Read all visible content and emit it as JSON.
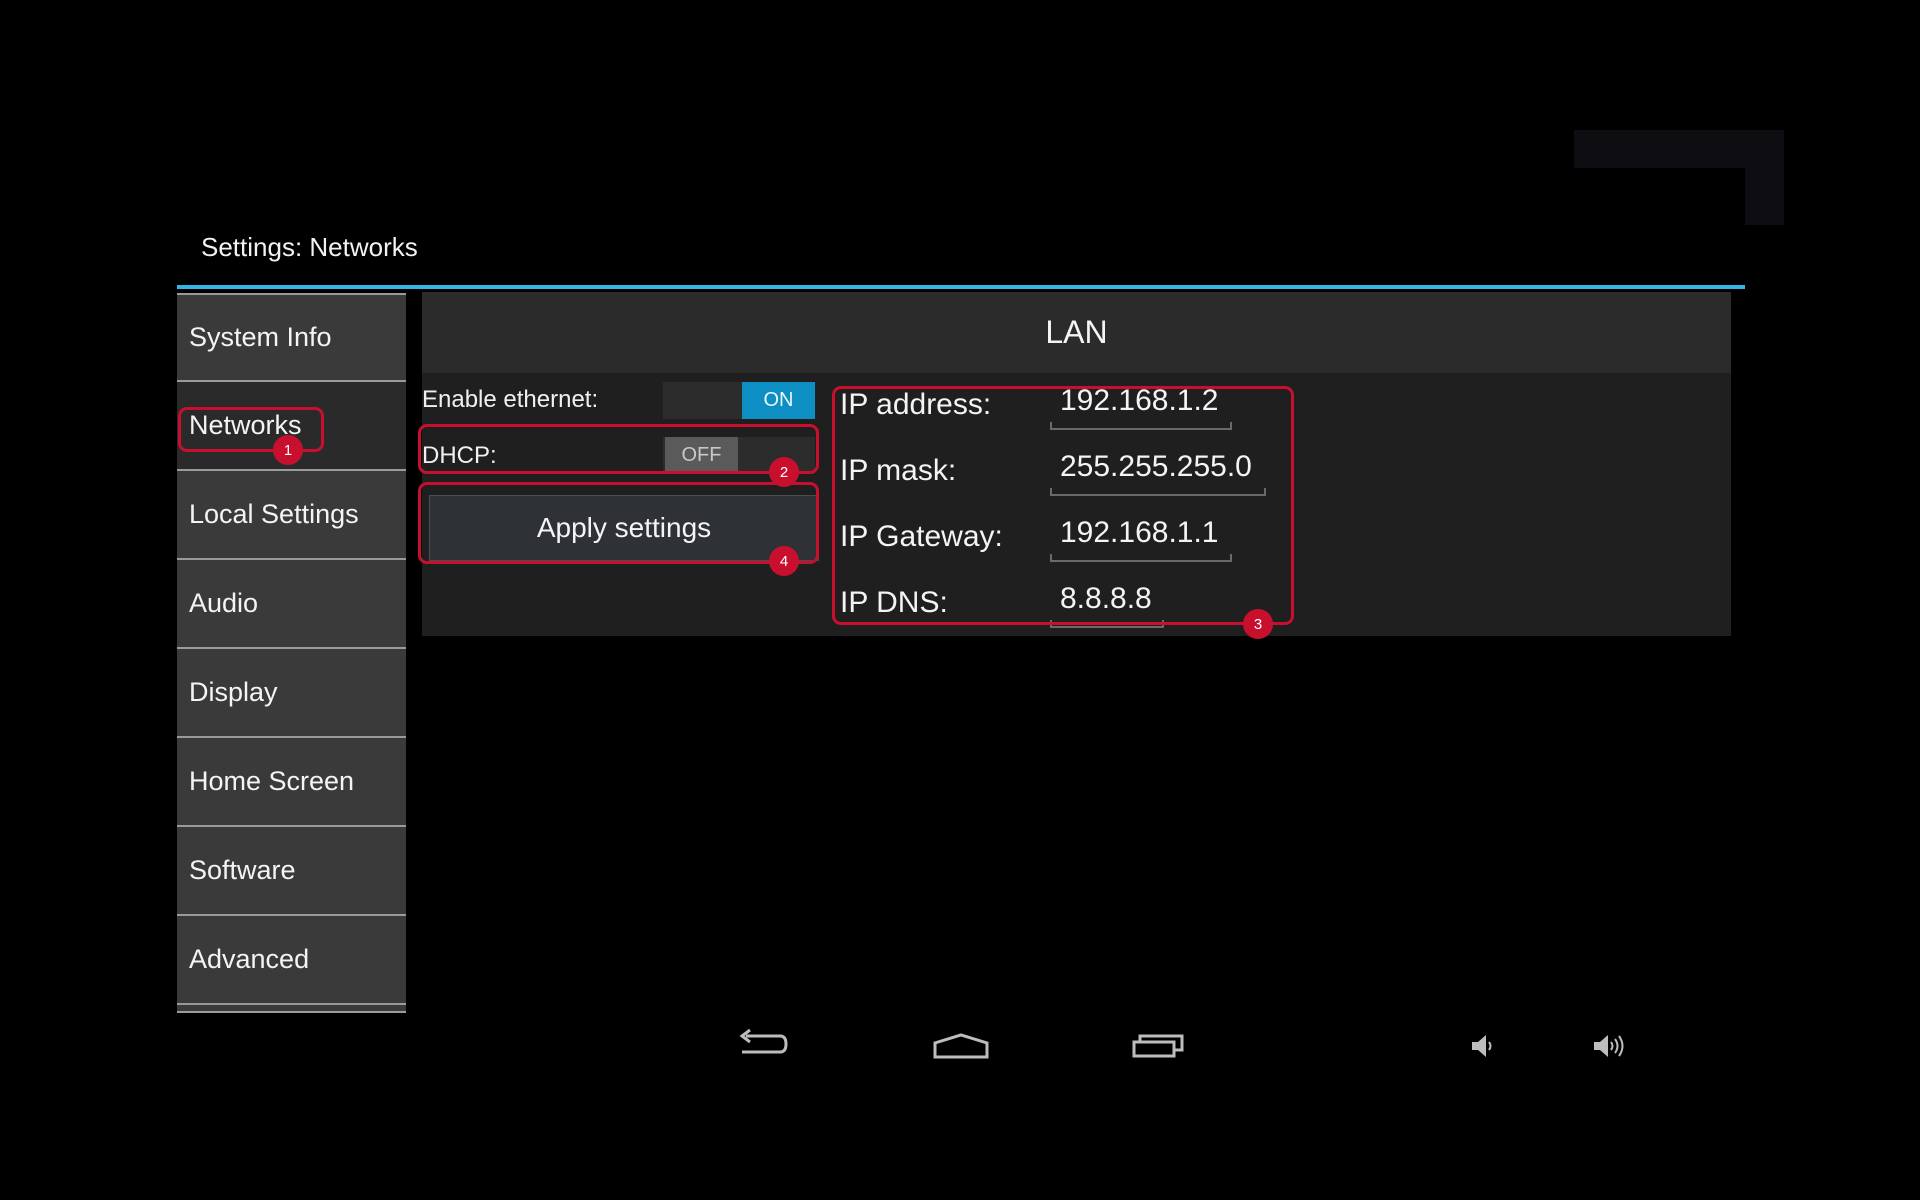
{
  "app": {
    "title": "Settings: Networks"
  },
  "sidebar": {
    "items": [
      {
        "label": "System Info"
      },
      {
        "label": "Networks"
      },
      {
        "label": "Local Settings"
      },
      {
        "label": "Audio"
      },
      {
        "label": "Display"
      },
      {
        "label": "Home Screen"
      },
      {
        "label": "Software"
      },
      {
        "label": "Advanced"
      }
    ],
    "selected": "Networks"
  },
  "lan": {
    "header": "LAN",
    "enable_ethernet": {
      "label": "Enable ethernet:",
      "state": "ON"
    },
    "dhcp": {
      "label": "DHCP:",
      "state": "OFF"
    },
    "apply_button": "Apply settings",
    "ip_address": {
      "label": "IP address:",
      "value": "192.168.1.2"
    },
    "ip_mask": {
      "label": "IP mask:",
      "value": "255.255.255.0"
    },
    "ip_gateway": {
      "label": "IP Gateway:",
      "value": "192.168.1.1"
    },
    "ip_dns": {
      "label": "IP DNS:",
      "value": "8.8.8.8"
    }
  },
  "annotations": {
    "badges": [
      "1",
      "2",
      "3",
      "4"
    ],
    "color": "#c8102e"
  },
  "colors": {
    "accent": "#33b5e5",
    "toggle_on": "#0e8fc4"
  },
  "navbar": {
    "icons": [
      "back-icon",
      "home-icon",
      "recent-apps-icon",
      "volume-down-icon",
      "volume-up-icon"
    ]
  }
}
